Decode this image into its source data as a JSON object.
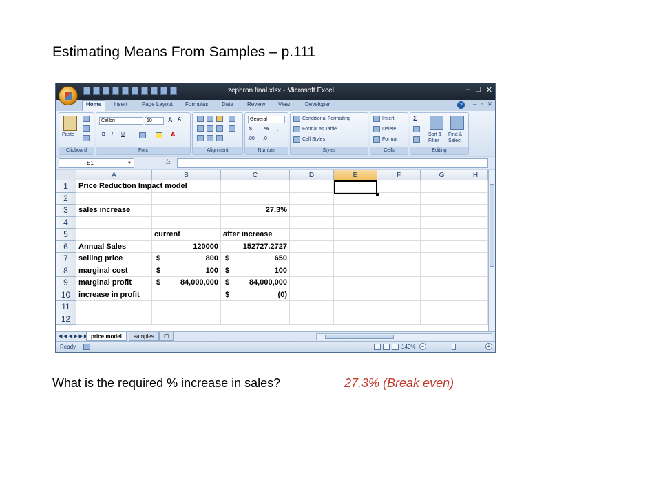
{
  "slide": {
    "title": "Estimating Means From Samples – p.111",
    "question": "What is the required % increase in sales?",
    "answer": "27.3% (Break even)"
  },
  "excel": {
    "window_title": "zephron final.xlsx - Microsoft Excel",
    "tabs": [
      "Home",
      "Insert",
      "Page Layout",
      "Formulas",
      "Data",
      "Review",
      "View",
      "Developer"
    ],
    "active_tab": "Home",
    "ribbon": {
      "clipboard": {
        "paste": "Paste",
        "label": "Clipboard"
      },
      "font": {
        "name": "Calibri",
        "size": "10",
        "bold": "B",
        "italic": "I",
        "underline": "U",
        "grow": "A",
        "shrink": "A",
        "label": "Font"
      },
      "alignment": {
        "label": "Alignment"
      },
      "number": {
        "format": "General",
        "currency": "$",
        "percent": "%",
        "comma": ",",
        "inc_decimal": ".00",
        "dec_decimal": ".0",
        "label": "Number"
      },
      "styles": {
        "conditional": "Conditional Formatting",
        "table": "Format as Table",
        "cell": "Cell Styles",
        "label": "Styles"
      },
      "cells": {
        "insert": "Insert",
        "delete": "Delete",
        "format": "Format",
        "label": "Cells"
      },
      "editing": {
        "sort": "Sort &",
        "filter": "Filter",
        "find": "Find &",
        "select": "Select",
        "label": "Editing"
      }
    },
    "name_box": "E1",
    "fx": "fx",
    "columns": [
      "A",
      "B",
      "C",
      "D",
      "E",
      "F",
      "G",
      "H"
    ],
    "selected_column": "E",
    "rows": [
      {
        "n": "1",
        "A": "Price Reduction Impact model",
        "B": "",
        "B_cur": "",
        "C": "",
        "C_cur": ""
      },
      {
        "n": "2",
        "A": "",
        "B": "",
        "B_cur": "",
        "C": "",
        "C_cur": ""
      },
      {
        "n": "3",
        "A": "sales increase",
        "B": "",
        "B_cur": "",
        "C": "27.3%",
        "C_cur": ""
      },
      {
        "n": "4",
        "A": "",
        "B": "",
        "B_cur": "",
        "C": "",
        "C_cur": ""
      },
      {
        "n": "5",
        "A": "",
        "B": "current",
        "B_cur": "",
        "C": "after increase",
        "C_cur": ""
      },
      {
        "n": "6",
        "A": "Annual Sales",
        "B": "120000",
        "B_cur": "",
        "C": "152727.2727",
        "C_cur": ""
      },
      {
        "n": "7",
        "A": "selling price",
        "B": "800",
        "B_cur": "$",
        "C": "650",
        "C_cur": "$"
      },
      {
        "n": "8",
        "A": "marginal cost",
        "B": "100",
        "B_cur": "$",
        "C": "100",
        "C_cur": "$"
      },
      {
        "n": "9",
        "A": "marginal profit",
        "B": "84,000,000",
        "B_cur": "$",
        "C": "84,000,000",
        "C_cur": "$"
      },
      {
        "n": "10",
        "A": "increase in profit",
        "B": "",
        "B_cur": "",
        "C": "(0)",
        "C_cur": "$"
      },
      {
        "n": "11",
        "A": "",
        "B": "",
        "B_cur": "",
        "C": "",
        "C_cur": ""
      },
      {
        "n": "12",
        "A": "",
        "B": "",
        "B_cur": "",
        "C": "",
        "C_cur": ""
      }
    ],
    "sheet_tabs": [
      "price model",
      "samples"
    ],
    "active_sheet": "price model",
    "status": "Ready",
    "zoom": "140%"
  }
}
